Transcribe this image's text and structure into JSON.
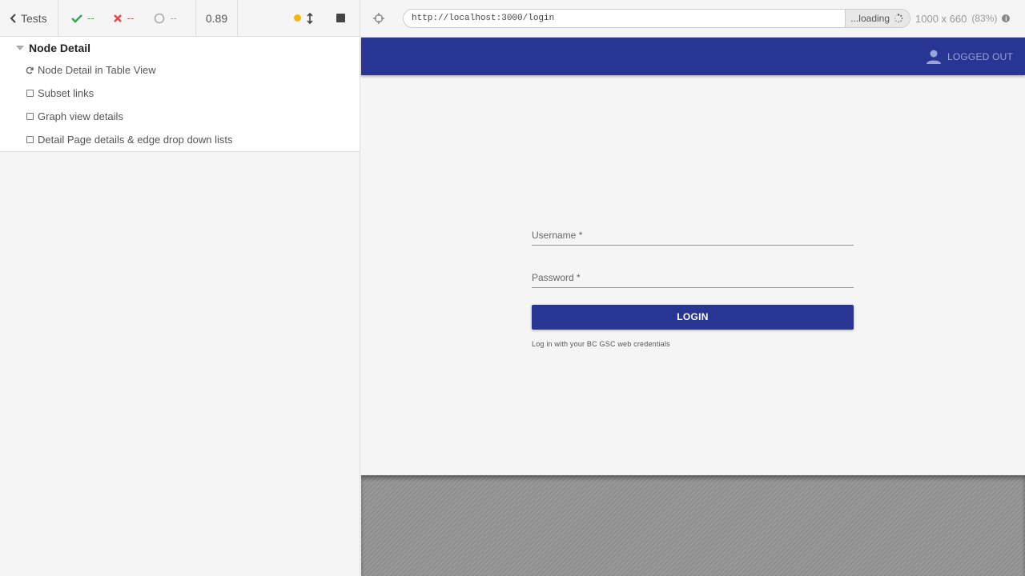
{
  "reporter": {
    "tests_label": "Tests",
    "stats": {
      "passed": "--",
      "failed": "--",
      "pending": "--"
    },
    "duration": "0.89",
    "suite": {
      "title": "Node Detail",
      "tests": [
        {
          "label": "Node Detail in Table View",
          "state": "running"
        },
        {
          "label": "Subset links",
          "state": "queued"
        },
        {
          "label": "Graph view details",
          "state": "queued"
        },
        {
          "label": "Detail Page details & edge drop down lists",
          "state": "queued"
        }
      ]
    }
  },
  "aut": {
    "url": "http://localhost:3000/login",
    "loading_label": "...loading",
    "viewport": "1000 x 660",
    "scale": "(83%)",
    "app": {
      "user_status": "LOGGED OUT",
      "username_label": "Username *",
      "password_label": "Password *",
      "login_button": "LOGIN",
      "hint": "Log in with your BC GSC web credentials"
    }
  },
  "colors": {
    "app_primary": "#283593",
    "pass": "#32a852",
    "fail": "#e8473f",
    "running_dot": "#f5b50a"
  }
}
